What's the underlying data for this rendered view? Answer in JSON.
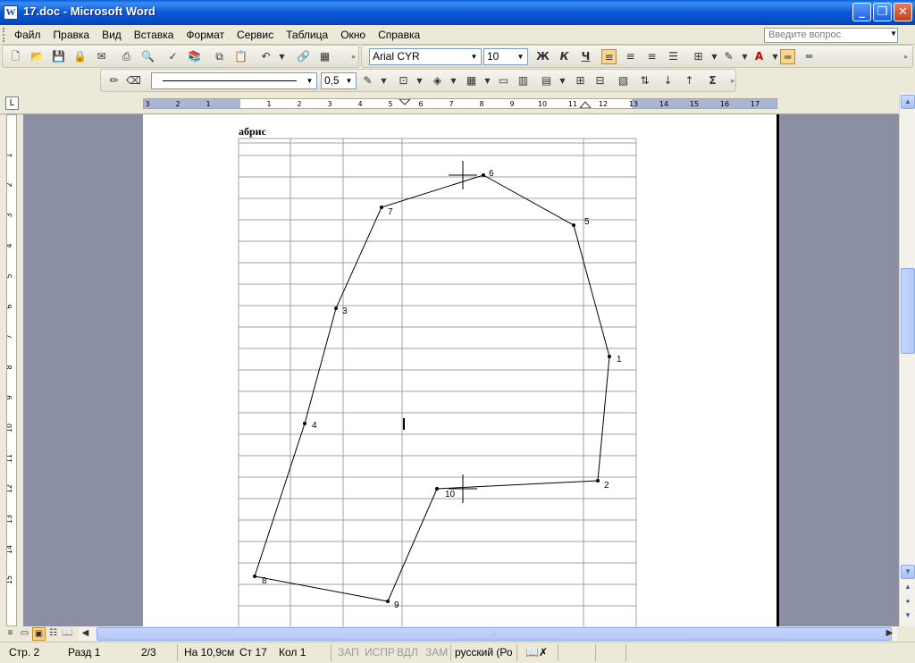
{
  "window": {
    "title": "17.doc - Microsoft Word",
    "app_icon": "W"
  },
  "menu": {
    "items": [
      "Файл",
      "Правка",
      "Вид",
      "Вставка",
      "Формат",
      "Сервис",
      "Таблица",
      "Окно",
      "Справка"
    ],
    "ask_placeholder": "Введите вопрос"
  },
  "formatting": {
    "font": "Arial CYR",
    "size": "10",
    "bold": "Ж",
    "italic": "К",
    "underline": "Ч"
  },
  "drawing_toolbar": {
    "line_weight": "0,5",
    "sum_symbol": "Σ"
  },
  "ruler": {
    "ticks": [
      "3",
      "2",
      "1",
      "1",
      "2",
      "3",
      "4",
      "5",
      "6",
      "7",
      "8",
      "9",
      "10",
      "11",
      "12",
      "13",
      "14",
      "15",
      "16",
      "17"
    ],
    "vticks": [
      "1",
      "1",
      "2",
      "3",
      "4",
      "5",
      "6",
      "7",
      "8",
      "9",
      "10",
      "11",
      "12",
      "13",
      "14",
      "15"
    ]
  },
  "document": {
    "heading": "абрис",
    "points": [
      {
        "label": "1"
      },
      {
        "label": "2"
      },
      {
        "label": "3"
      },
      {
        "label": "4"
      },
      {
        "label": "5"
      },
      {
        "label": "6"
      },
      {
        "label": "7"
      },
      {
        "label": "8"
      },
      {
        "label": "9"
      },
      {
        "label": "10"
      }
    ]
  },
  "status": {
    "page": "Стр. 2",
    "section": "Разд 1",
    "pages": "2/3",
    "position": "На 10,9см",
    "line": "Ст 17",
    "column": "Кол 1",
    "rec": "ЗАП",
    "track": "ИСПР",
    "ext": "ВДЛ",
    "ovr": "ЗАМ",
    "language": "русский (Ро"
  },
  "colors": {
    "titlebar": "#0a58d6",
    "highlight": "#fbd588",
    "workspace": "#8a8fa4"
  }
}
